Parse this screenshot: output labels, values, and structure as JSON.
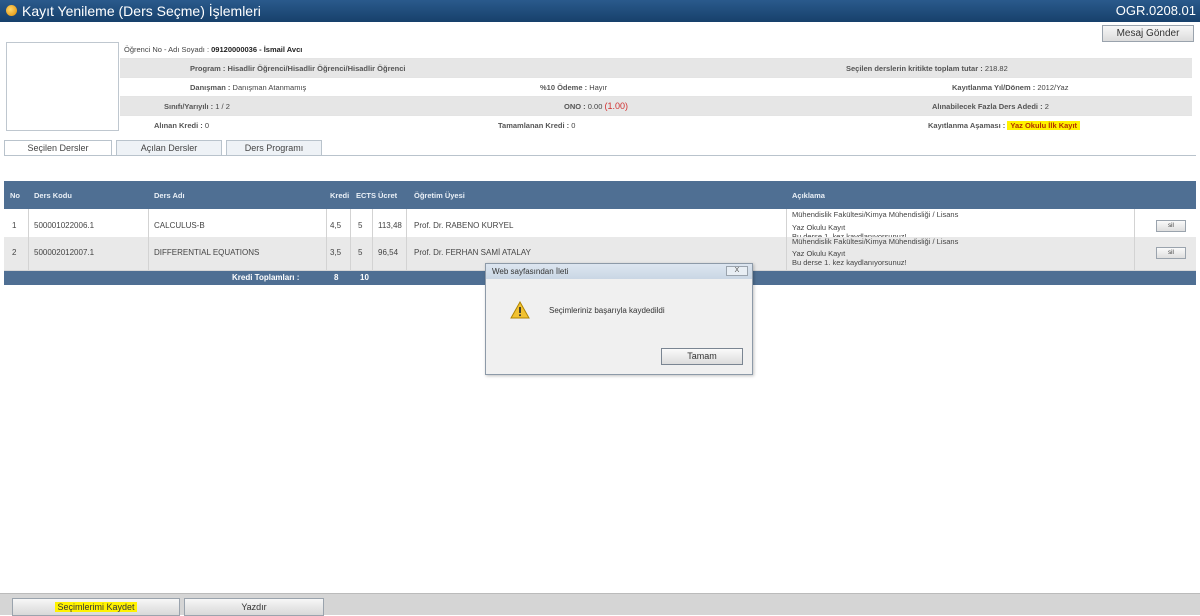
{
  "window": {
    "title": "Kayıt Yenileme (Ders Seçme) İşlemleri",
    "code": "OGR.0208.01"
  },
  "header": {
    "message_button": "Mesaj Gönder"
  },
  "student": {
    "id_label": "Öğrenci No - Adı Soyadı :",
    "id_value": "09120000036 - İsmail Avcı",
    "program_label": "Program :",
    "program_value": "Hisadlir Öğrenci/Hisadlir Öğrenci/Hisadlir Öğrenci",
    "credit_total_label": "Seçilen derslerin kritikte toplam tutar :",
    "credit_total_value": "218.82",
    "advisor_label": "Danışman :",
    "advisor_value": "Danışman Atanmamış",
    "discount_label": "%10 Ödeme :",
    "discount_value": "Hayır",
    "term_label": "Kayıtlanma Yıl/Dönem :",
    "term_value": "2012/Yaz",
    "class_label": "Sınıfı/Yarıyılı :",
    "class_value": "1 / 2",
    "gpa_label": "ONO :",
    "gpa_value": "0.00",
    "gpa_extra": "(1.00)",
    "max_courses_label": "Alınabilecek Fazla Ders Adedi :",
    "max_courses_value": "2",
    "credits_taken_label": "Alınan Kredi :",
    "credits_taken_value": "0",
    "credits_completed_label": "Tamamlanan Kredi :",
    "credits_completed_value": "0",
    "stage_label": "Kayıtlanma Aşaması :",
    "stage_value": "Yaz Okulu İlk Kayıt"
  },
  "tabs": [
    "Seçilen Dersler",
    "Açılan Dersler",
    "Ders Programı"
  ],
  "table": {
    "columns": [
      "No",
      "Ders Kodu",
      "Ders Adı",
      "Kredi",
      "ECTS",
      "Ücret",
      "Öğretim Üyesi",
      "Açıklama"
    ],
    "rows": [
      {
        "no": "1",
        "code": "500001022006.1",
        "name": "CALCULUS-B",
        "credit": "4,5",
        "ects": "5",
        "fee": "113,48",
        "instructor": "Prof. Dr. RABENO KURYEL",
        "desc1": "Mühendislik Fakültesi/Kimya Mühendisliği / Lisans",
        "desc2": "Yaz Okulu Kayıt",
        "desc3": "Bu derse 1. kez kaydlanıyorsunuz!",
        "action": "sil"
      },
      {
        "no": "2",
        "code": "500002012007.1",
        "name": "DIFFERENTIAL EQUATIONS",
        "credit": "3,5",
        "ects": "5",
        "fee": "96,54",
        "instructor": "Prof. Dr. FERHAN SAMİ ATALAY",
        "desc1": "Mühendislik Fakültesi/Kimya Mühendisliği / Lisans",
        "desc2": "Yaz Okulu Kayıt",
        "desc3": "Bu derse 1. kez kaydlanıyorsunuz!",
        "action": "sil"
      }
    ],
    "footer_label": "Kredi Toplamları :",
    "footer_credit": "8",
    "footer_ects": "10"
  },
  "dialog": {
    "title": "Web sayfasından İleti",
    "close": "X",
    "message": "Seçimleriniz başarıyla kaydedildi",
    "ok": "Tamam"
  },
  "bottom": {
    "save": "Seçimlerimi Kaydet",
    "print": "Yazdır"
  },
  "colors": {
    "title_bar": "#17406b",
    "grid_header": "#4f6f93",
    "highlight": "#fff200"
  }
}
